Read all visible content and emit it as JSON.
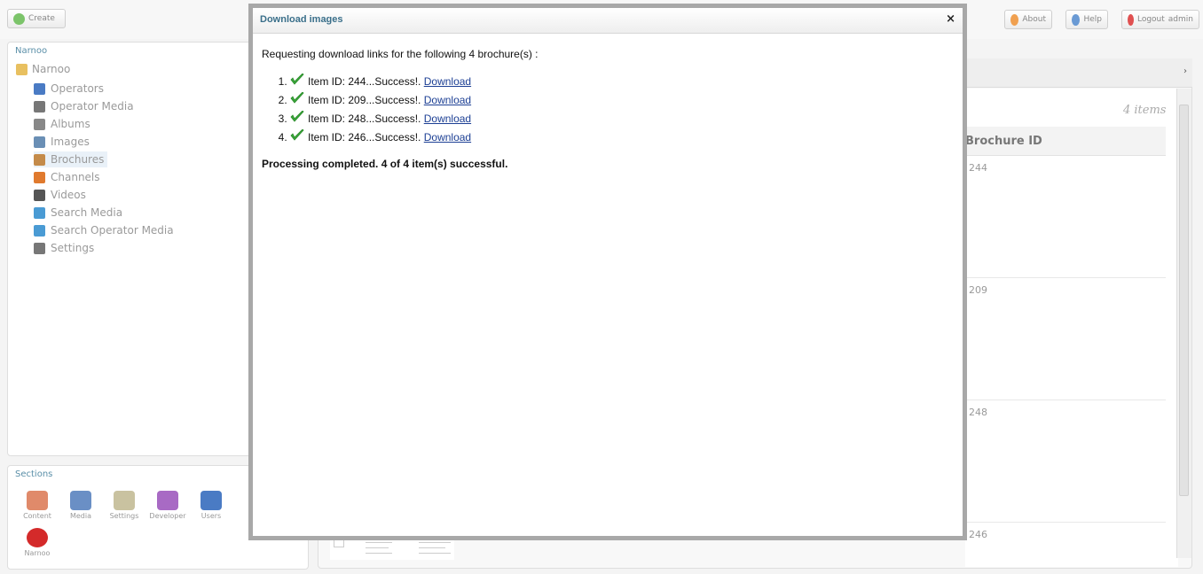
{
  "toolbar": {
    "create_label": "Create",
    "about_label": "About",
    "help_label": "Help",
    "logout_label": "Logout",
    "user": "admin"
  },
  "tree": {
    "panel_title": "Narnoo",
    "root_label": "Narnoo",
    "items": [
      {
        "label": "Operators",
        "icon": "user-icon",
        "color": "#4a7bc4"
      },
      {
        "label": "Operator Media",
        "icon": "media-icon",
        "color": "#777777"
      },
      {
        "label": "Albums",
        "icon": "album-icon",
        "color": "#888888"
      },
      {
        "label": "Images",
        "icon": "image-icon",
        "color": "#6a8fb5"
      },
      {
        "label": "Brochures",
        "icon": "brochure-icon",
        "color": "#c48b4a"
      },
      {
        "label": "Channels",
        "icon": "channel-icon",
        "color": "#e07a2e"
      },
      {
        "label": "Videos",
        "icon": "video-icon",
        "color": "#555555"
      },
      {
        "label": "Search Media",
        "icon": "search-icon",
        "color": "#4a9bd4"
      },
      {
        "label": "Search Operator Media",
        "icon": "search-icon",
        "color": "#4a9bd4"
      },
      {
        "label": "Settings",
        "icon": "tools-icon",
        "color": "#777777"
      }
    ]
  },
  "sections": {
    "title": "Sections",
    "items": [
      {
        "label": "Content",
        "icon": "content-icon",
        "color": "#e08a6a"
      },
      {
        "label": "Media",
        "icon": "media-icon",
        "color": "#6a8fc5"
      },
      {
        "label": "Settings",
        "icon": "settings-icon",
        "color": "#c9c2a0"
      },
      {
        "label": "Developer",
        "icon": "developer-icon",
        "color": "#a86ac4"
      },
      {
        "label": "Users",
        "icon": "users-icon",
        "color": "#4a7bc4"
      },
      {
        "label": "Narnoo",
        "icon": "narnoo-icon",
        "color": "#d42a2a"
      }
    ]
  },
  "list": {
    "count_text": "4 items",
    "column_header": "Brochure ID",
    "ids": [
      "244",
      "209",
      "248",
      "246"
    ]
  },
  "dialog": {
    "title": "Download images",
    "close_glyph": "×",
    "intro": "Requesting download links for the following 4 brochure(s) :",
    "results": [
      {
        "text": "Item ID: 244...Success!.",
        "link": "Download"
      },
      {
        "text": "Item ID: 209...Success!.",
        "link": "Download"
      },
      {
        "text": "Item ID: 248...Success!.",
        "link": "Download"
      },
      {
        "text": "Item ID: 246...Success!.",
        "link": "Download"
      }
    ],
    "summary": "Processing completed. 4 of 4 item(s) successful."
  }
}
